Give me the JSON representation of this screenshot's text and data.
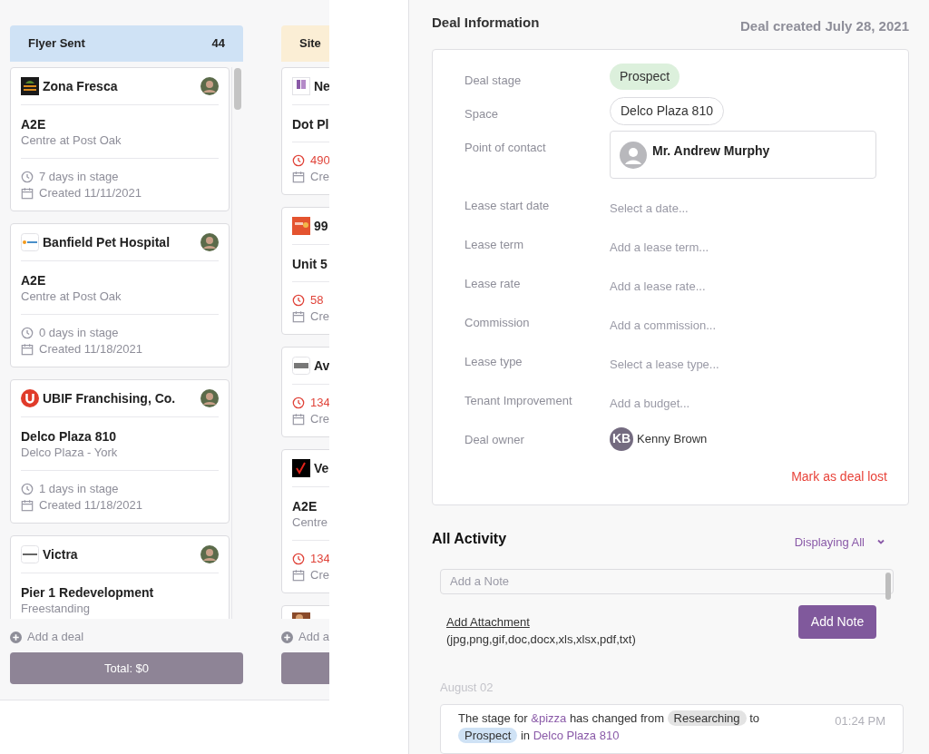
{
  "board": {
    "columns": [
      {
        "title": "Flyer Sent",
        "count": "44",
        "color": "#cfe2f5",
        "add": "Add a deal",
        "total": "Total: $0",
        "cards": [
          {
            "kind": "zona",
            "company": "Zona Fresca",
            "avatar": true,
            "space": "A2E",
            "property": "Centre at Post Oak",
            "days": "7 days in stage",
            "overdue": false,
            "created": "Created 11/11/2021"
          },
          {
            "kind": "banfield",
            "company": "Banfield Pet Hospital",
            "avatar": true,
            "space": "A2E",
            "property": "Centre at Post Oak",
            "days": "0 days in stage",
            "overdue": false,
            "created": "Created 11/18/2021"
          },
          {
            "kind": "ubif",
            "company": "UBIF Franchising, Co.",
            "avatar": true,
            "space": "Delco Plaza 810",
            "property": "Delco Plaza - York",
            "days": "1 days in stage",
            "overdue": false,
            "created": "Created 11/18/2021"
          },
          {
            "kind": "victra",
            "company": "Victra",
            "avatar": true,
            "space": "Pier 1 Redevelopment",
            "property": "Freestanding"
          }
        ]
      },
      {
        "title": "Site",
        "color": "#fbeed5",
        "add": "Add a",
        "cards": [
          {
            "kind": "purple",
            "company": "Ne",
            "space": "Dot Pl",
            "days": "490",
            "overdue": true,
            "created": "Cre"
          },
          {
            "kind": "orange",
            "company": "99",
            "space": "Unit 5",
            "days": "58",
            "overdue": true,
            "created": "Cre"
          },
          {
            "kind": "grey",
            "company": "Av",
            "days": "134",
            "overdue": true,
            "created": "Cre"
          },
          {
            "kind": "check",
            "company": "Ve",
            "space": "A2E",
            "property": "Centre",
            "days": "134",
            "overdue": true,
            "created": "Cre"
          },
          {
            "kind": "photo"
          }
        ]
      }
    ]
  },
  "deal": {
    "title": "Deal Information",
    "created": "Deal created July 28, 2021",
    "fields": [
      {
        "label": "Deal stage",
        "kind": "tag",
        "value": "Prospect"
      },
      {
        "label": "Space",
        "kind": "chip",
        "value": "Delco Plaza 810"
      },
      {
        "label": "Point of contact",
        "kind": "contact",
        "value": "Mr. Andrew Murphy"
      },
      {
        "label": "Lease start date",
        "kind": "empty",
        "placeholder": "Select a date..."
      },
      {
        "label": "Lease term",
        "kind": "empty",
        "placeholder": "Add a lease term..."
      },
      {
        "label": "Lease rate",
        "kind": "empty",
        "placeholder": "Add a lease rate..."
      },
      {
        "label": "Commission",
        "kind": "empty",
        "placeholder": "Add a commission..."
      },
      {
        "label": "Lease type",
        "kind": "empty",
        "placeholder": "Select a lease type..."
      },
      {
        "label": "Tenant Improvement",
        "kind": "empty",
        "placeholder": "Add a budget..."
      },
      {
        "label": "Deal owner",
        "kind": "owner",
        "initials": "KB",
        "value": "Kenny Brown"
      }
    ],
    "lost": "Mark as deal lost"
  },
  "activity": {
    "title": "All Activity",
    "filter": "Displaying All",
    "note_placeholder": "Add a Note",
    "attachment": "Add Attachment",
    "formats": "(jpg,png,gif,doc,docx,xls,xlsx,pdf,txt)",
    "button": "Add Note",
    "date": "August 02",
    "entries": [
      {
        "time": "01:24 PM",
        "parts": [
          {
            "kind": "text",
            "text": "The stage for"
          },
          {
            "kind": "link",
            "text": "&pizza"
          },
          {
            "kind": "text",
            "text": "has changed from"
          },
          {
            "kind": "pill",
            "text": "Researching",
            "color": "#e3e3e3"
          },
          {
            "kind": "text",
            "text": "to"
          },
          {
            "kind": "pill",
            "text": "Prospect",
            "color": "#cfe2f5"
          },
          {
            "kind": "text",
            "text": "in"
          },
          {
            "kind": "link",
            "text": "Delco Plaza 810"
          }
        ]
      }
    ]
  }
}
